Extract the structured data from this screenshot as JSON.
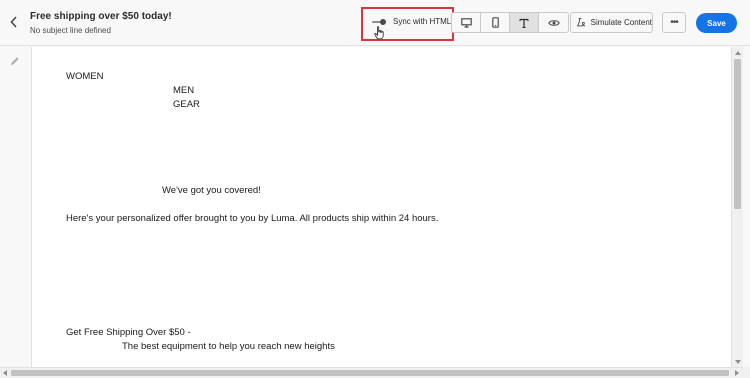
{
  "header": {
    "title": "Free shipping over $50 today!",
    "subtitle": "No subject line defined",
    "sync_label": "Sync with HTML",
    "sync_enabled": true,
    "view_modes": [
      "desktop-icon",
      "mobile-icon",
      "text-icon",
      "eye-icon"
    ],
    "active_view_mode": "text-icon",
    "simulate_label": "Simulate Content",
    "more_label": "•••",
    "save_label": "Save"
  },
  "colors": {
    "accent": "#1473e6",
    "highlight_box": "#d7373f"
  },
  "content": {
    "nav_women": "WOMEN",
    "nav_men": "MEN",
    "nav_gear": "GEAR",
    "headline": "We've got you covered!",
    "body": "Here's your personalized offer brought to you by Luma. All products ship within 24 hours.",
    "promo_title": "Get Free Shipping Over $50 -",
    "promo_sub": "The best equipment to help you reach new heights"
  }
}
